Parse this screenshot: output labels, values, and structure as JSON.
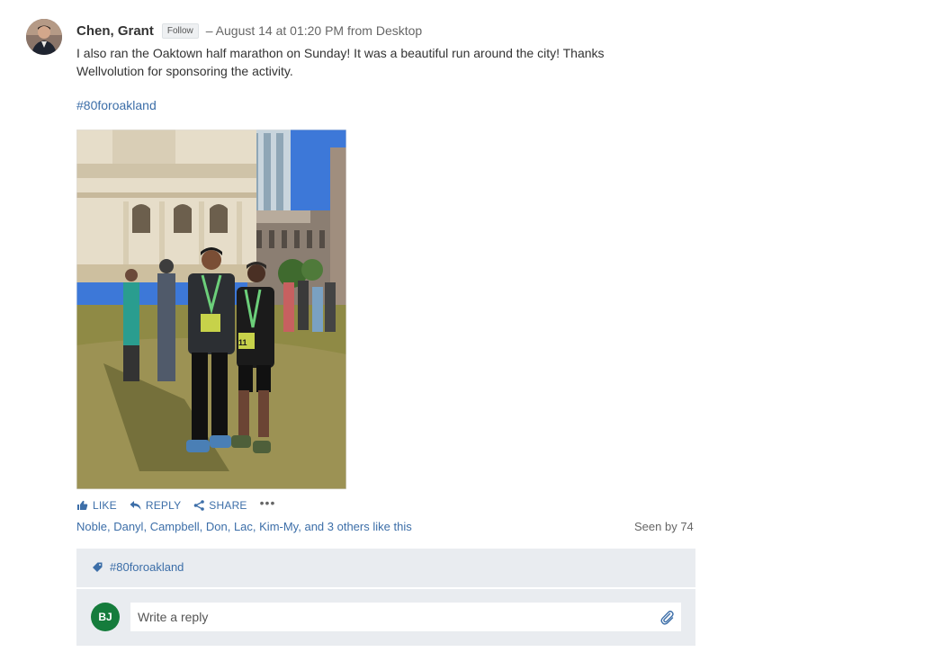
{
  "post": {
    "author": "Chen, Grant",
    "follow_label": "Follow",
    "meta": "– August 14 at 01:20 PM from Desktop",
    "body_line1": "I also ran the Oaktown half marathon on Sunday!  It was a beautiful run around the city!  Thanks",
    "body_line2": "Wellvolution for sponsoring the activity.",
    "hashtag": "#80foroakland",
    "photo_subject": "Two runners with medals in front of city hall",
    "number_11": "11"
  },
  "actions": {
    "like": "LIKE",
    "reply": "REPLY",
    "share": "SHARE",
    "more": "•••"
  },
  "likes": {
    "names": [
      "Noble",
      "Danyl",
      "Campbell",
      "Don",
      "Lac",
      "Kim-My"
    ],
    "sep": ", ",
    "and_text": ", and ",
    "others": "3 others",
    "suffix": " like this"
  },
  "seen": "Seen by 74",
  "topic": {
    "label": "#80foroakland",
    "icon": "tag-icon"
  },
  "reply": {
    "avatar_initials": "BJ",
    "placeholder": "Write a reply",
    "attach_icon": "paperclip-icon"
  },
  "colors": {
    "link": "#3c6ea8",
    "panel": "#e9ecf0",
    "avatar_green": "#157c3c"
  }
}
